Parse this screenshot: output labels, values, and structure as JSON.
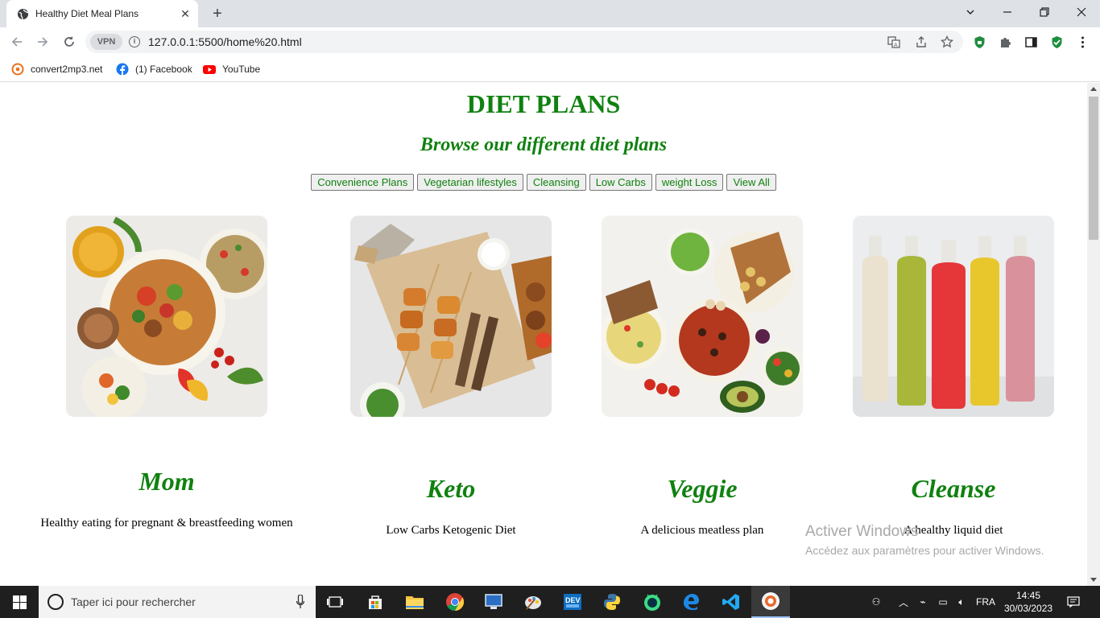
{
  "browser": {
    "tab_title": "Healthy Diet Meal Plans",
    "vpn_label": "VPN",
    "url": "127.0.0.1:5500/home%20.html",
    "bookmarks": [
      {
        "label": "convert2mp3.net",
        "icon": "convert2mp3-icon"
      },
      {
        "label": "(1) Facebook",
        "icon": "facebook-icon"
      },
      {
        "label": "YouTube",
        "icon": "youtube-icon"
      }
    ]
  },
  "page": {
    "title": "DIET PLANS",
    "subtitle": "Browse our different diet plans",
    "filters": [
      "Convenience Plans",
      "Vegetarian lifestyles",
      "Cleansing",
      "Low Carbs",
      "weight Loss",
      "View All"
    ],
    "plans": [
      {
        "name": "Mom",
        "description": "Healthy eating for pregnant & breastfeeding women",
        "image": "mixed-meal-bowls-photo"
      },
      {
        "name": "Keto",
        "description": "Low Carbs Ketogenic Diet",
        "image": "kebab-skewers-photo"
      },
      {
        "name": "Veggie",
        "description": "A delicious meatless plan",
        "image": "vegetarian-spread-photo"
      },
      {
        "name": "Cleanse",
        "description": "A healthy liquid diet",
        "image": "juice-bottles-photo"
      }
    ],
    "accent_color": "#108110"
  },
  "watermark": {
    "line1": "Activer Windows",
    "line2": "Accédez aux paramètres pour activer Windows."
  },
  "taskbar": {
    "search_placeholder": "Taper ici pour rechercher",
    "language": "FRA",
    "time": "14:45",
    "date": "30/03/2023"
  }
}
